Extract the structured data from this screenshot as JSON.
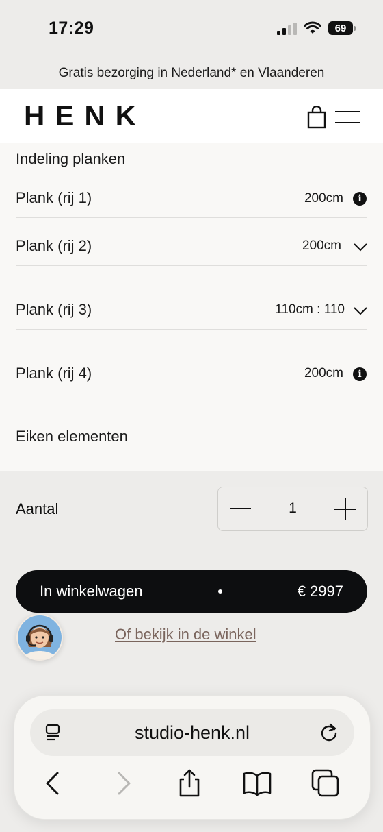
{
  "status_bar": {
    "time": "17:29",
    "battery": "69"
  },
  "promo": {
    "text": "Gratis bezorging in Nederland* en Vlaanderen"
  },
  "header": {
    "logo": "HENK"
  },
  "config": {
    "heading": "Indeling planken",
    "rows": [
      {
        "label": "Plank (rij 1)",
        "value": "200cm",
        "control": "info-icon"
      },
      {
        "label": "Plank (rij 2)",
        "value": "200cm",
        "control": "chevron-down-icon"
      },
      {
        "label": "Plank (rij 3)",
        "value": "110cm : 110",
        "control": "chevron-down-icon"
      },
      {
        "label": "Plank (rij 4)",
        "value": "200cm",
        "control": "info-icon"
      }
    ],
    "subheading": "Eiken elementen"
  },
  "quantity": {
    "label": "Aantal",
    "value": "1"
  },
  "cart_button": {
    "label": "In winkelwagen",
    "price": "€ 2997"
  },
  "store_link": {
    "label": "Of bekijk in de winkel"
  },
  "browser": {
    "url": "studio-henk.nl"
  },
  "colors": {
    "button": "#0d0e10",
    "link": "#7a655d",
    "background": "#edecea"
  }
}
